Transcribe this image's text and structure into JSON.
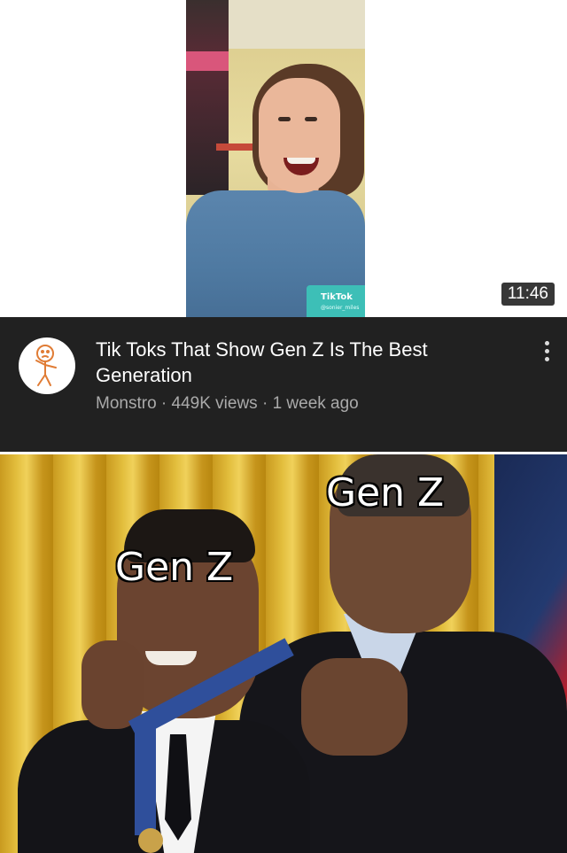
{
  "video": {
    "duration": "11:46",
    "watermark": {
      "logo_text": "TikTok",
      "username": "@sonier_miles"
    },
    "title": "Tik Toks That Show Gen Z Is The Best Generation",
    "meta": "Monstro · 449K views · 1 week ago",
    "channel_avatar_icon": "stick-figure-icon",
    "more_icon": "vertical-dots-icon"
  },
  "meme": {
    "label_top": "Gen Z",
    "label_left": "Gen Z"
  },
  "colors": {
    "info_bg": "#212121",
    "title_text": "#ffffff",
    "meta_text": "#aaaaaa",
    "avatar_stroke": "#e07c35"
  }
}
